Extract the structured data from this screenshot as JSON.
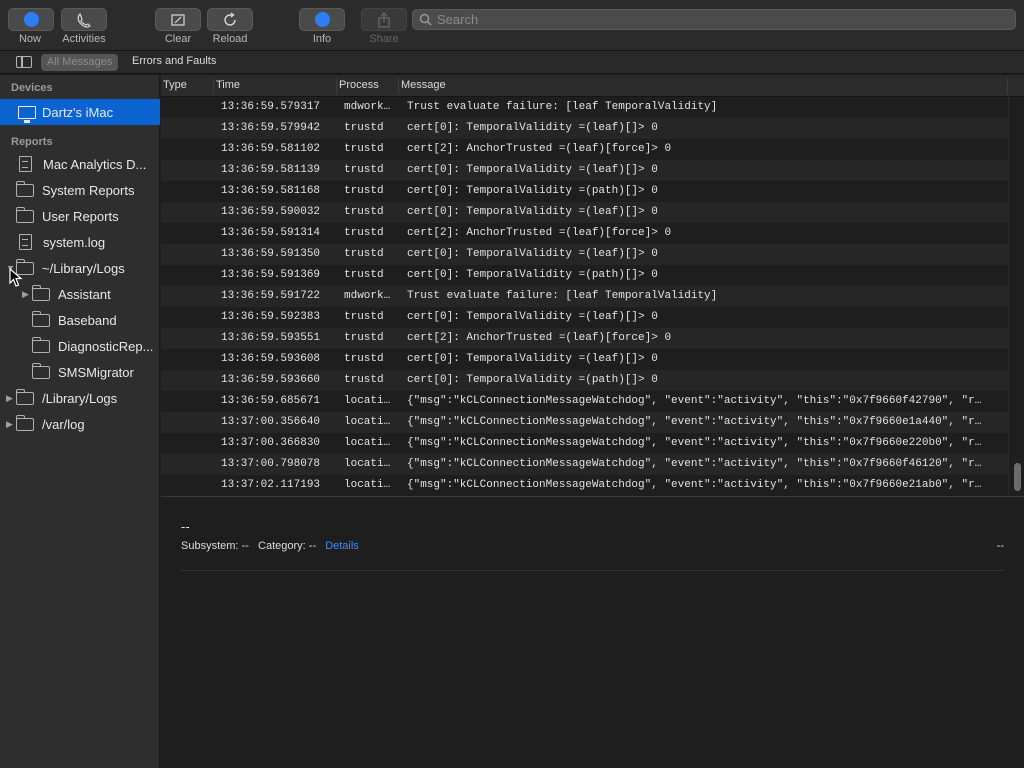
{
  "toolbar": {
    "now": "Now",
    "activities": "Activities",
    "clear": "Clear",
    "reload": "Reload",
    "info": "Info",
    "share": "Share",
    "search_placeholder": "Search"
  },
  "filters": {
    "all_messages": "All Messages",
    "errors_and_faults": "Errors and Faults"
  },
  "sidebar": {
    "devices_heading": "Devices",
    "device": "Dartz's iMac",
    "reports_heading": "Reports",
    "items": [
      {
        "label": "Mac Analytics D...",
        "icon": "doc"
      },
      {
        "label": "System Reports",
        "icon": "folder"
      },
      {
        "label": "User Reports",
        "icon": "folder"
      },
      {
        "label": "system.log",
        "icon": "doc"
      },
      {
        "label": "~/Library/Logs",
        "icon": "folder",
        "expanded": true
      },
      {
        "label": "Assistant",
        "icon": "folder",
        "child": true,
        "collapsed": true
      },
      {
        "label": "Baseband",
        "icon": "folder",
        "child": true
      },
      {
        "label": "DiagnosticRep...",
        "icon": "folder",
        "child": true
      },
      {
        "label": "SMSMigrator",
        "icon": "folder",
        "child": true
      },
      {
        "label": "/Library/Logs",
        "icon": "folder",
        "collapsed": true
      },
      {
        "label": "/var/log",
        "icon": "folder",
        "collapsed": true
      }
    ]
  },
  "table": {
    "headers": {
      "type": "Type",
      "time": "Time",
      "process": "Process",
      "message": "Message"
    },
    "rows": [
      {
        "time": "13:36:59.579317",
        "process": "mdwork…",
        "message": "Trust evaluate failure: [leaf TemporalValidity]"
      },
      {
        "time": "13:36:59.579942",
        "process": "trustd",
        "message": "cert[0]: TemporalValidity =(leaf)[]> 0"
      },
      {
        "time": "13:36:59.581102",
        "process": "trustd",
        "message": "cert[2]: AnchorTrusted =(leaf)[force]> 0"
      },
      {
        "time": "13:36:59.581139",
        "process": "trustd",
        "message": "cert[0]: TemporalValidity =(leaf)[]> 0"
      },
      {
        "time": "13:36:59.581168",
        "process": "trustd",
        "message": "cert[0]: TemporalValidity =(path)[]> 0"
      },
      {
        "time": "13:36:59.590032",
        "process": "trustd",
        "message": "cert[0]: TemporalValidity =(leaf)[]> 0"
      },
      {
        "time": "13:36:59.591314",
        "process": "trustd",
        "message": "cert[2]: AnchorTrusted =(leaf)[force]> 0"
      },
      {
        "time": "13:36:59.591350",
        "process": "trustd",
        "message": "cert[0]: TemporalValidity =(leaf)[]> 0"
      },
      {
        "time": "13:36:59.591369",
        "process": "trustd",
        "message": "cert[0]: TemporalValidity =(path)[]> 0"
      },
      {
        "time": "13:36:59.591722",
        "process": "mdwork…",
        "message": "Trust evaluate failure: [leaf TemporalValidity]"
      },
      {
        "time": "13:36:59.592383",
        "process": "trustd",
        "message": "cert[0]: TemporalValidity =(leaf)[]> 0"
      },
      {
        "time": "13:36:59.593551",
        "process": "trustd",
        "message": "cert[2]: AnchorTrusted =(leaf)[force]> 0"
      },
      {
        "time": "13:36:59.593608",
        "process": "trustd",
        "message": "cert[0]: TemporalValidity =(leaf)[]> 0"
      },
      {
        "time": "13:36:59.593660",
        "process": "trustd",
        "message": "cert[0]: TemporalValidity =(path)[]> 0"
      },
      {
        "time": "13:36:59.685671",
        "process": "locati…",
        "message": "{\"msg\":\"kCLConnectionMessageWatchdog\", \"event\":\"activity\", \"this\":\"0x7f9660f42790\", \"r…"
      },
      {
        "time": "13:37:00.356640",
        "process": "locati…",
        "message": "{\"msg\":\"kCLConnectionMessageWatchdog\", \"event\":\"activity\", \"this\":\"0x7f9660e1a440\", \"r…"
      },
      {
        "time": "13:37:00.366830",
        "process": "locati…",
        "message": "{\"msg\":\"kCLConnectionMessageWatchdog\", \"event\":\"activity\", \"this\":\"0x7f9660e220b0\", \"r…"
      },
      {
        "time": "13:37:00.798078",
        "process": "locati…",
        "message": "{\"msg\":\"kCLConnectionMessageWatchdog\", \"event\":\"activity\", \"this\":\"0x7f9660f46120\", \"r…"
      },
      {
        "time": "13:37:02.117193",
        "process": "locati…",
        "message": "{\"msg\":\"kCLConnectionMessageWatchdog\", \"event\":\"activity\", \"this\":\"0x7f9660e21ab0\", \"r…"
      }
    ]
  },
  "details": {
    "dash": "--",
    "subsystem_label": "Subsystem:",
    "subsystem_value": "--",
    "category_label": "Category:",
    "category_value": "--",
    "details_link": "Details",
    "right_value": "--"
  },
  "colors": {
    "selection": "#0a63d1",
    "link": "#3f8ff4",
    "now_indicator": "#2e7df6"
  }
}
